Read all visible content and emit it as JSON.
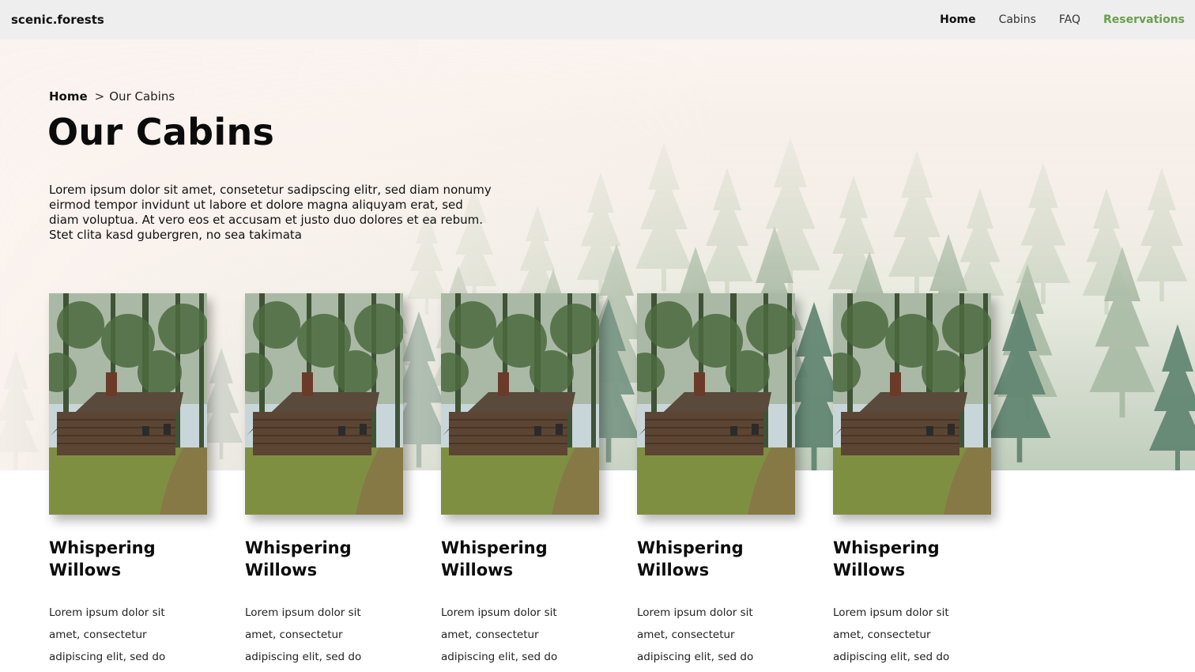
{
  "nav": {
    "brand": "scenic.forests",
    "links": [
      {
        "label": "Home",
        "state": "active"
      },
      {
        "label": "Cabins",
        "state": "default"
      },
      {
        "label": "FAQ",
        "state": "default"
      },
      {
        "label": "Reservations",
        "state": "cta"
      }
    ]
  },
  "colors": {
    "nav_bg": "#eeeeee",
    "cta_green": "#6a9f4b",
    "text_dark": "#0b0b0b"
  },
  "breadcrumb": {
    "home": "Home",
    "separator": ">",
    "current": "Our Cabins"
  },
  "page": {
    "title": "Our Cabins",
    "intro": "Lorem ipsum dolor sit amet, consetetur sadipscing elitr, sed diam nonumy eirmod tempor invidunt ut labore et dolore magna aliquyam erat, sed diam voluptua. At vero eos et accusam et justo duo dolores et ea rebum. Stet clita kasd gubergren, no sea takimata"
  },
  "cabins": [
    {
      "title": "Whispering Willows",
      "text": "Lorem ipsum dolor sit amet, consectetur adipiscing elit, sed do eiusmod tempor"
    },
    {
      "title": "Whispering Willows",
      "text": "Lorem ipsum dolor sit amet, consectetur adipiscing elit, sed do eiusmod tempor"
    },
    {
      "title": "Whispering Willows",
      "text": "Lorem ipsum dolor sit amet, consectetur adipiscing elit, sed do eiusmod tempor"
    },
    {
      "title": "Whispering Willows",
      "text": "Lorem ipsum dolor sit amet, consectetur adipiscing elit, sed do eiusmod tempor"
    },
    {
      "title": "Whispering Willows",
      "text": "Lorem ipsum dolor sit amet, consectetur adipiscing elit, sed do eiusmod tempor"
    }
  ],
  "icons": {
    "hero_image": "foggy-forest-image",
    "cabin_image": "log-cabin-photo"
  }
}
